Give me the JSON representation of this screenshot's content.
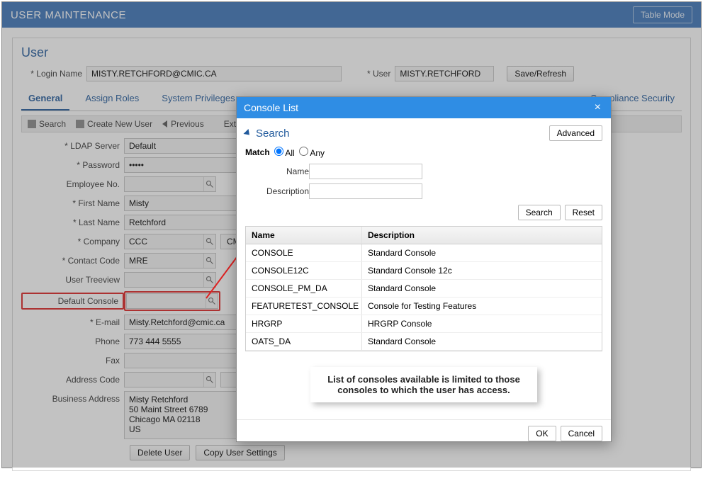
{
  "header": {
    "title": "USER MAINTENANCE",
    "table_mode": "Table Mode"
  },
  "panel": {
    "title": "User",
    "login_label": "Login Name",
    "login_value": "MISTY.RETCHFORD@CMIC.CA",
    "user_label": "User",
    "user_value": "MISTY.RETCHFORD",
    "save_label": "Save/Refresh"
  },
  "tabs": {
    "general": "General",
    "assign": "Assign Roles",
    "privs": "System Privileges",
    "compliance": "Compliance Security",
    "extensions": "Extensions"
  },
  "toolbar": {
    "search": "Search",
    "create": "Create New User",
    "previous": "Previous"
  },
  "form": {
    "ldap_label": "LDAP Server",
    "ldap_value": "Default",
    "password_label": "Password",
    "password_value": "•••••",
    "emp_label": "Employee No.",
    "emp_value": "",
    "first_label": "First Name",
    "first_value": "Misty",
    "last_label": "Last Name",
    "last_value": "Retchford",
    "company_label": "Company",
    "company_value": "CCC",
    "company_desc": "CMiC",
    "contact_label": "Contact Code",
    "contact_value": "MRE",
    "treeview_label": "User Treeview",
    "treeview_value": "",
    "console_label": "Default Console",
    "console_value": "",
    "email_label": "E-mail",
    "email_value": "Misty.Retchford@cmic.ca",
    "phone_label": "Phone",
    "phone_value": "773 444 5555",
    "fax_label": "Fax",
    "fax_value": "",
    "addr_code_label": "Address Code",
    "addr_code_value": "",
    "bus_addr_label": "Business Address",
    "bus_addr_value": "Misty Retchford\n50 Maint Street 6789\nChicago MA 02118\nUS",
    "delete_btn": "Delete User",
    "copy_btn": "Copy User Settings"
  },
  "modal": {
    "title": "Console List",
    "search_header": "Search",
    "advanced_btn": "Advanced",
    "match_label": "Match",
    "match_all": "All",
    "match_any": "Any",
    "name_label": "Name",
    "desc_label": "Description",
    "search_btn": "Search",
    "reset_btn": "Reset",
    "col_name": "Name",
    "col_desc": "Description",
    "rows": [
      {
        "name": "CONSOLE",
        "desc": "Standard Console"
      },
      {
        "name": "CONSOLE12C",
        "desc": "Standard Console 12c"
      },
      {
        "name": "CONSOLE_PM_DA",
        "desc": "Standard Console"
      },
      {
        "name": "FEATURETEST_CONSOLE",
        "desc": "Console for Testing Features"
      },
      {
        "name": "HRGRP",
        "desc": "HRGRP Console"
      },
      {
        "name": "OATS_DA",
        "desc": "Standard Console"
      }
    ],
    "note": "List of consoles available is limited to those consoles to which the user has access.",
    "ok_btn": "OK",
    "cancel_btn": "Cancel"
  }
}
